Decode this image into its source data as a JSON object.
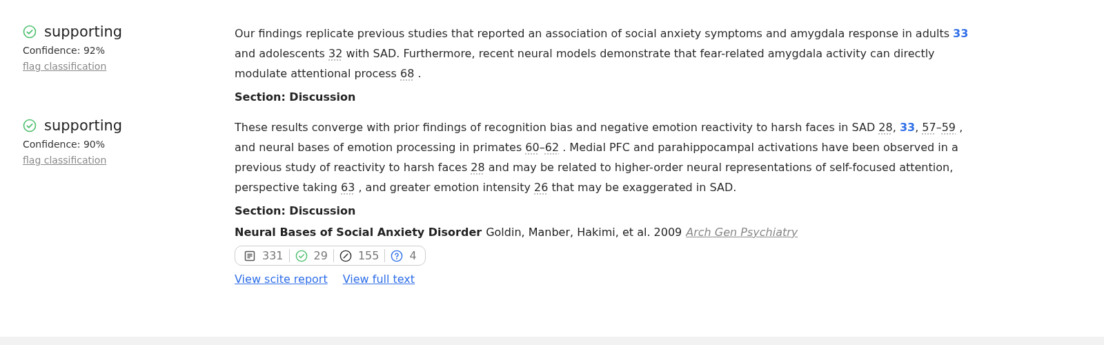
{
  "citations": [
    {
      "classification": {
        "label": "supporting",
        "kind": "supporting",
        "confidence": "Confidence: 92%",
        "flag": "flag classification"
      },
      "snippet": [
        {
          "kind": "text",
          "text": "Our findings replicate previous studies that reported an association of social anxiety symptoms and amygdala response in adults "
        },
        {
          "kind": "cite",
          "text": "33",
          "highlighted": true
        },
        {
          "kind": "text",
          "text": " and adolescents "
        },
        {
          "kind": "cite",
          "text": "32",
          "highlighted": false
        },
        {
          "kind": "text",
          "text": " with SAD. Furthermore, recent neural models demonstrate that fear-related amygdala activity can directly modulate attentional process "
        },
        {
          "kind": "cite",
          "text": "68",
          "highlighted": false
        },
        {
          "kind": "text",
          "text": " ."
        }
      ],
      "section": "Section: Discussion"
    },
    {
      "classification": {
        "label": "supporting",
        "kind": "supporting",
        "confidence": "Confidence: 90%",
        "flag": "flag classification"
      },
      "snippet": [
        {
          "kind": "text",
          "text": "These results converge with prior findings of recognition bias and negative emotion reactivity to harsh faces in SAD "
        },
        {
          "kind": "cite",
          "text": "28",
          "highlighted": false
        },
        {
          "kind": "text",
          "text": ", "
        },
        {
          "kind": "cite",
          "text": "33",
          "highlighted": true
        },
        {
          "kind": "text",
          "text": ", "
        },
        {
          "kind": "cite",
          "text": "57",
          "highlighted": false
        },
        {
          "kind": "text",
          "text": "–"
        },
        {
          "kind": "cite",
          "text": "59",
          "highlighted": false
        },
        {
          "kind": "text",
          "text": " , and neural bases of emotion processing in primates "
        },
        {
          "kind": "cite",
          "text": "60",
          "highlighted": false
        },
        {
          "kind": "text",
          "text": "–"
        },
        {
          "kind": "cite",
          "text": "62",
          "highlighted": false
        },
        {
          "kind": "text",
          "text": " . Medial PFC and parahippocampal activations have been observed in a previous study of reactivity to harsh faces "
        },
        {
          "kind": "cite",
          "text": "28",
          "highlighted": false
        },
        {
          "kind": "text",
          "text": " and may be related to higher-order neural representations of self-focused attention, perspective taking "
        },
        {
          "kind": "cite",
          "text": "63",
          "highlighted": false
        },
        {
          "kind": "text",
          "text": " , and greater emotion intensity "
        },
        {
          "kind": "cite",
          "text": "26",
          "highlighted": false
        },
        {
          "kind": "text",
          "text": " that may be exaggerated in SAD."
        }
      ],
      "section": "Section: Discussion"
    }
  ],
  "paper": {
    "title": "Neural Bases of Social Anxiety Disorder",
    "authors": "Goldin, Manber, Hakimi, et al. 2009",
    "journal": "Arch Gen Psychiatry",
    "tallies": [
      {
        "kind": "publications",
        "count": "331"
      },
      {
        "kind": "supporting",
        "count": "29"
      },
      {
        "kind": "contrasting",
        "count": "155"
      },
      {
        "kind": "mentioning",
        "count": "4"
      }
    ],
    "links": [
      "View scite report",
      "View full text"
    ]
  }
}
